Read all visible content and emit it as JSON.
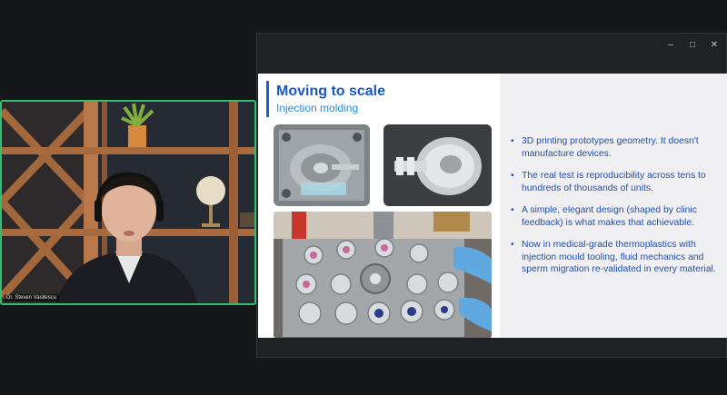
{
  "window": {
    "controls": {
      "minimize": "–",
      "maximize": "□",
      "close": "✕"
    }
  },
  "participant": {
    "name": "Dr. Steven Vasilescu"
  },
  "slide": {
    "title": "Moving to scale",
    "subtitle": "Injection molding",
    "bullets": [
      "3D printing prototypes geometry. It doesn't manufacture devices.",
      "The real test is reproducibility across tens to hundreds of thousands of units.",
      "A simple, elegant design (shaped by clinic feedback) is what makes that achievable.",
      "Now in medical-grade thermoplastics with injection mould tooling, fluid mechanics and sperm migration re-validated in every material."
    ]
  },
  "colors": {
    "accent": "#1a57c4",
    "subtitle": "#2a8bd6",
    "active_speaker_border": "#2fbf71"
  }
}
